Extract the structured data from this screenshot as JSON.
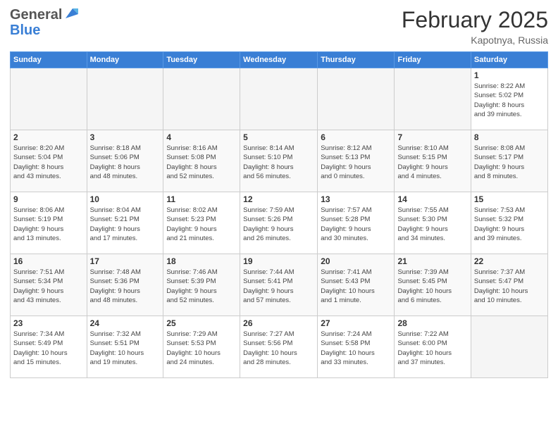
{
  "header": {
    "logo_general": "General",
    "logo_blue": "Blue",
    "month_title": "February 2025",
    "location": "Kapotnya, Russia"
  },
  "weekdays": [
    "Sunday",
    "Monday",
    "Tuesday",
    "Wednesday",
    "Thursday",
    "Friday",
    "Saturday"
  ],
  "days": [
    {
      "date": "",
      "info": ""
    },
    {
      "date": "",
      "info": ""
    },
    {
      "date": "",
      "info": ""
    },
    {
      "date": "",
      "info": ""
    },
    {
      "date": "",
      "info": ""
    },
    {
      "date": "",
      "info": ""
    },
    {
      "date": "1",
      "info": "Sunrise: 8:22 AM\nSunset: 5:02 PM\nDaylight: 8 hours\nand 39 minutes."
    },
    {
      "date": "2",
      "info": "Sunrise: 8:20 AM\nSunset: 5:04 PM\nDaylight: 8 hours\nand 43 minutes."
    },
    {
      "date": "3",
      "info": "Sunrise: 8:18 AM\nSunset: 5:06 PM\nDaylight: 8 hours\nand 48 minutes."
    },
    {
      "date": "4",
      "info": "Sunrise: 8:16 AM\nSunset: 5:08 PM\nDaylight: 8 hours\nand 52 minutes."
    },
    {
      "date": "5",
      "info": "Sunrise: 8:14 AM\nSunset: 5:10 PM\nDaylight: 8 hours\nand 56 minutes."
    },
    {
      "date": "6",
      "info": "Sunrise: 8:12 AM\nSunset: 5:13 PM\nDaylight: 9 hours\nand 0 minutes."
    },
    {
      "date": "7",
      "info": "Sunrise: 8:10 AM\nSunset: 5:15 PM\nDaylight: 9 hours\nand 4 minutes."
    },
    {
      "date": "8",
      "info": "Sunrise: 8:08 AM\nSunset: 5:17 PM\nDaylight: 9 hours\nand 8 minutes."
    },
    {
      "date": "9",
      "info": "Sunrise: 8:06 AM\nSunset: 5:19 PM\nDaylight: 9 hours\nand 13 minutes."
    },
    {
      "date": "10",
      "info": "Sunrise: 8:04 AM\nSunset: 5:21 PM\nDaylight: 9 hours\nand 17 minutes."
    },
    {
      "date": "11",
      "info": "Sunrise: 8:02 AM\nSunset: 5:23 PM\nDaylight: 9 hours\nand 21 minutes."
    },
    {
      "date": "12",
      "info": "Sunrise: 7:59 AM\nSunset: 5:26 PM\nDaylight: 9 hours\nand 26 minutes."
    },
    {
      "date": "13",
      "info": "Sunrise: 7:57 AM\nSunset: 5:28 PM\nDaylight: 9 hours\nand 30 minutes."
    },
    {
      "date": "14",
      "info": "Sunrise: 7:55 AM\nSunset: 5:30 PM\nDaylight: 9 hours\nand 34 minutes."
    },
    {
      "date": "15",
      "info": "Sunrise: 7:53 AM\nSunset: 5:32 PM\nDaylight: 9 hours\nand 39 minutes."
    },
    {
      "date": "16",
      "info": "Sunrise: 7:51 AM\nSunset: 5:34 PM\nDaylight: 9 hours\nand 43 minutes."
    },
    {
      "date": "17",
      "info": "Sunrise: 7:48 AM\nSunset: 5:36 PM\nDaylight: 9 hours\nand 48 minutes."
    },
    {
      "date": "18",
      "info": "Sunrise: 7:46 AM\nSunset: 5:39 PM\nDaylight: 9 hours\nand 52 minutes."
    },
    {
      "date": "19",
      "info": "Sunrise: 7:44 AM\nSunset: 5:41 PM\nDaylight: 9 hours\nand 57 minutes."
    },
    {
      "date": "20",
      "info": "Sunrise: 7:41 AM\nSunset: 5:43 PM\nDaylight: 10 hours\nand 1 minute."
    },
    {
      "date": "21",
      "info": "Sunrise: 7:39 AM\nSunset: 5:45 PM\nDaylight: 10 hours\nand 6 minutes."
    },
    {
      "date": "22",
      "info": "Sunrise: 7:37 AM\nSunset: 5:47 PM\nDaylight: 10 hours\nand 10 minutes."
    },
    {
      "date": "23",
      "info": "Sunrise: 7:34 AM\nSunset: 5:49 PM\nDaylight: 10 hours\nand 15 minutes."
    },
    {
      "date": "24",
      "info": "Sunrise: 7:32 AM\nSunset: 5:51 PM\nDaylight: 10 hours\nand 19 minutes."
    },
    {
      "date": "25",
      "info": "Sunrise: 7:29 AM\nSunset: 5:53 PM\nDaylight: 10 hours\nand 24 minutes."
    },
    {
      "date": "26",
      "info": "Sunrise: 7:27 AM\nSunset: 5:56 PM\nDaylight: 10 hours\nand 28 minutes."
    },
    {
      "date": "27",
      "info": "Sunrise: 7:24 AM\nSunset: 5:58 PM\nDaylight: 10 hours\nand 33 minutes."
    },
    {
      "date": "28",
      "info": "Sunrise: 7:22 AM\nSunset: 6:00 PM\nDaylight: 10 hours\nand 37 minutes."
    },
    {
      "date": "",
      "info": ""
    }
  ]
}
